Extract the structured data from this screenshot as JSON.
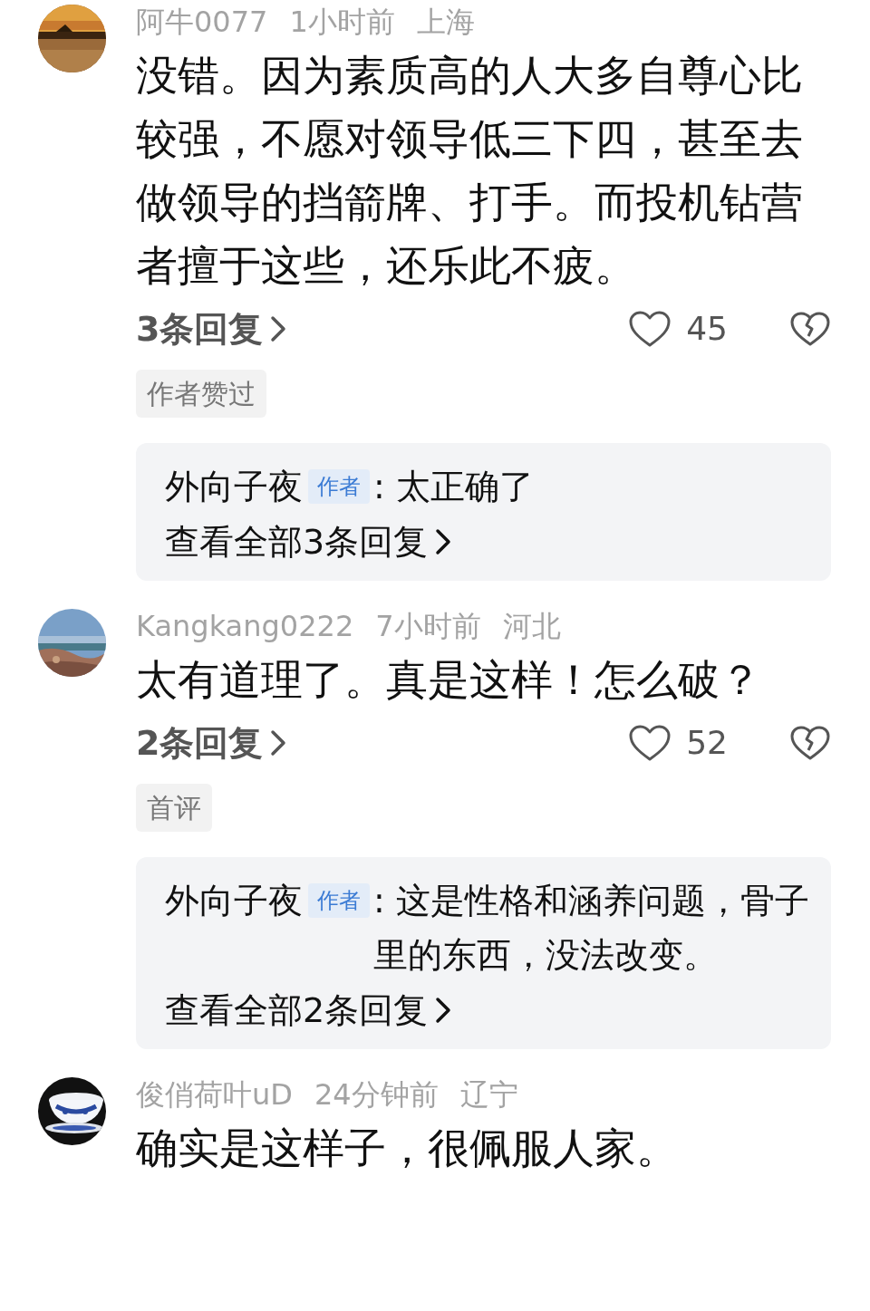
{
  "comments": [
    {
      "user": "阿牛0077",
      "time": "1小时前",
      "location": "上海",
      "text": "没错。因为素质高的人大多自尊心比较强，不愿对领导低三下四，甚至去做领导的挡箭牌、打手。而投机钻营者擅于这些，还乐此不疲。",
      "replies_link": "3条回复",
      "likes": "45",
      "tag": "作者赞过",
      "reply_box": {
        "name": "外向子夜",
        "badge": "作者",
        "text": ": 太正确了",
        "more": "查看全部3条回复"
      }
    },
    {
      "user": "Kangkang0222",
      "time": "7小时前",
      "location": "河北",
      "text": "太有道理了。真是这样！怎么破？",
      "replies_link": "2条回复",
      "likes": "52",
      "tag": "首评",
      "reply_box": {
        "name": "外向子夜",
        "badge": "作者",
        "text": ": 这是性格和涵养问题，骨子里的东西，没法改变。",
        "more": "查看全部2条回复"
      }
    },
    {
      "user": "俊俏荷叶uD",
      "time": "24分钟前",
      "location": "辽宁",
      "text": "确实是这样子，很佩服人家。"
    }
  ]
}
